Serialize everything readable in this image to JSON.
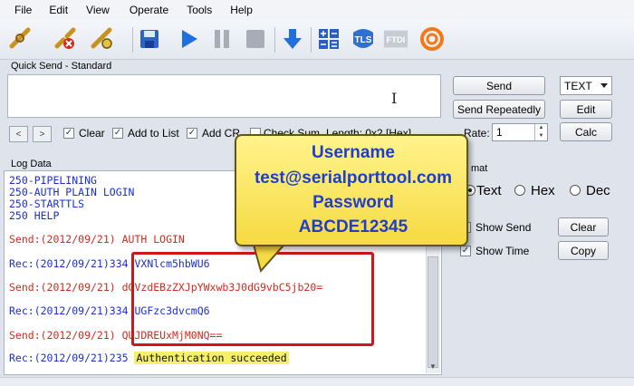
{
  "menu": [
    "File",
    "Edit",
    "View",
    "Operate",
    "Tools",
    "Help"
  ],
  "toolbar": {
    "icons": [
      "connect-icon",
      "disconnect-icon",
      "settings-icon",
      "save-icon",
      "play-icon",
      "pause-icon",
      "stop-icon",
      "download-icon",
      "calculator-icon",
      "tls-icon",
      "ftdi-icon",
      "help-icon"
    ],
    "tls_label": "TLS",
    "ftdi_label": "FTDI"
  },
  "quick_send": {
    "label": "Quick Send - Standard",
    "input_value": "",
    "send_label": "Send",
    "send_repeatedly_label": "Send Repeatedly",
    "mode_value": "TEXT",
    "edit_label": "Edit",
    "calc_label": "Calc",
    "rate_label": "Rate:",
    "rate_value": "1",
    "nav_prev": "<",
    "nav_next": ">",
    "clear_label": "Clear",
    "add_to_list_label": "Add to List",
    "add_cr_label": "Add CR",
    "check_sum_label": "Check Sum",
    "length_label": "Length: 0x2 [Hex]"
  },
  "log": {
    "title": "Log Data",
    "lines": [
      {
        "text": "250-PIPELINING",
        "kind": "rec"
      },
      {
        "text": "250-AUTH PLAIN LOGIN",
        "kind": "rec"
      },
      {
        "text": "250-STARTTLS",
        "kind": "rec"
      },
      {
        "text": "250 HELP",
        "kind": "rec"
      },
      {
        "text": "Send:(2012/09/21) AUTH LOGIN",
        "kind": "send"
      },
      {
        "text": "Rec:(2012/09/21)334 VXNlcm5hbWU6",
        "kind": "rec"
      },
      {
        "text": "Send:(2012/09/21) dGVzdEBzZXJpYWxwb3J0dG9vbC5jb20=",
        "kind": "send"
      },
      {
        "text": "Rec:(2012/09/21)334 UGFzc3dvcmQ6",
        "kind": "rec"
      },
      {
        "text": "Send:(2012/09/21) QUJDREUxMjM0NQ==",
        "kind": "send"
      },
      {
        "text_prefix": "Rec:(2012/09/21)235 ",
        "highlight": "Authentication succeeded",
        "kind": "rec"
      }
    ]
  },
  "display_format": {
    "label": "mat",
    "options": [
      "Text",
      "Hex",
      "Dec"
    ],
    "selected": "Text",
    "show_send_label": "Show Send",
    "show_time_label": "Show Time",
    "clear_label": "Clear",
    "copy_label": "Copy"
  },
  "callout": {
    "username_heading": "Username",
    "username_value": "test@serialporttool.com",
    "password_heading": "Password",
    "password_value": "ABCDE12345"
  },
  "colors": {
    "send_text": "#d42a1e",
    "rec_text": "#1a2fd6",
    "callout_bg": "#f6da42",
    "annotation_box": "#d01616"
  }
}
